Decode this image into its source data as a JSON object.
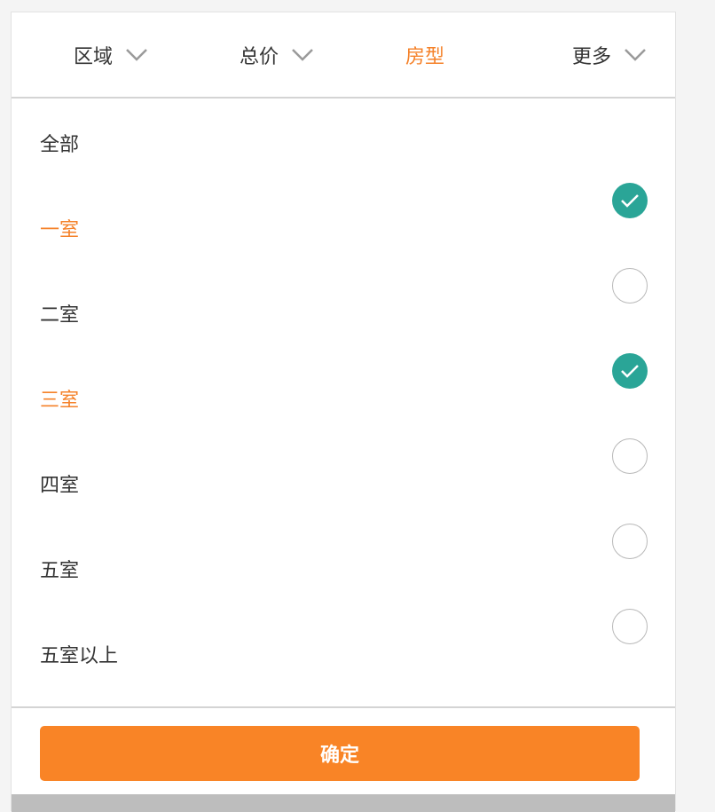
{
  "tabs": [
    {
      "label": "区域",
      "active": false,
      "has_chevron": true
    },
    {
      "label": "总价",
      "active": false,
      "has_chevron": true
    },
    {
      "label": "房型",
      "active": true,
      "has_chevron": false
    },
    {
      "label": "更多",
      "active": false,
      "has_chevron": true
    }
  ],
  "header_option": {
    "label": "全部"
  },
  "options": [
    {
      "label": "一室",
      "checked": true
    },
    {
      "label": "二室",
      "checked": false
    },
    {
      "label": "三室",
      "checked": true
    },
    {
      "label": "四室",
      "checked": false
    },
    {
      "label": "五室",
      "checked": false
    },
    {
      "label": "五室以上",
      "checked": false
    }
  ],
  "confirm_label": "确定",
  "colors": {
    "accent": "#f5822a",
    "button": "#f98426",
    "check_on": "#2aa597",
    "text": "#333333"
  },
  "icons": {
    "tab_chevron": "chevron-down-icon",
    "checked": "checkmark-circle-icon",
    "unchecked": "empty-circle-icon"
  }
}
